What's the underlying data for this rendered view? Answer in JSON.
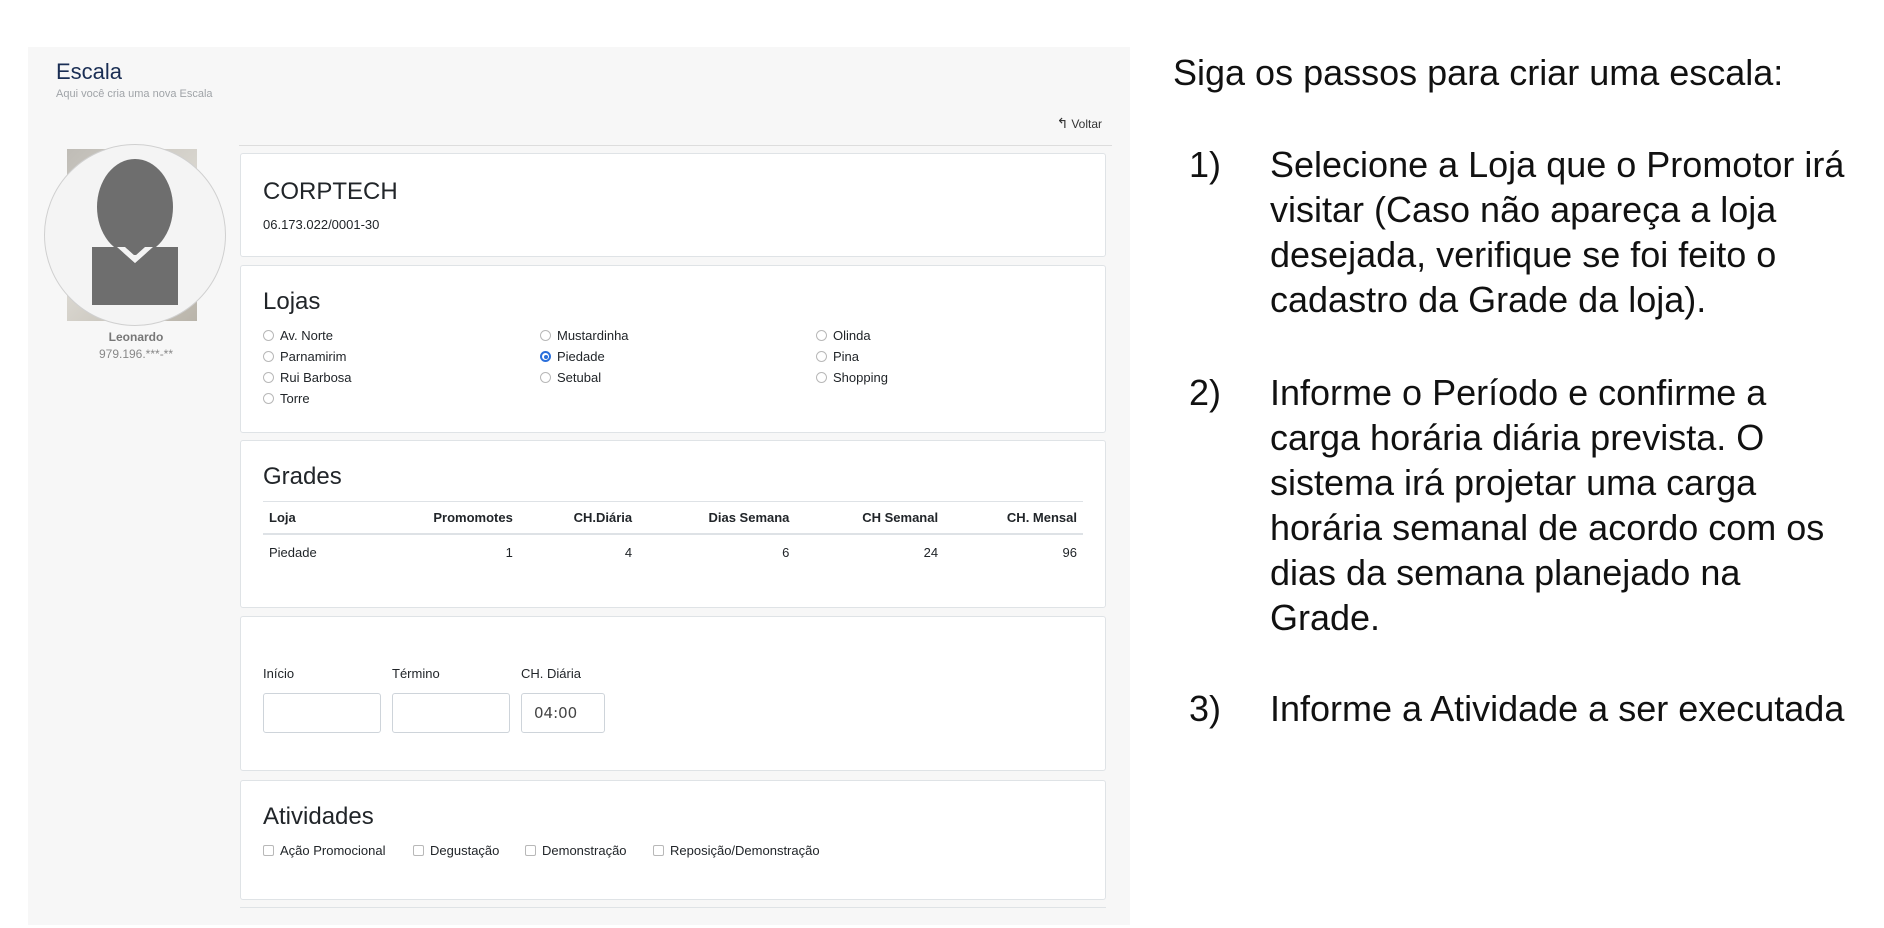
{
  "header": {
    "title": "Escala",
    "subtitle": "Aqui você cria uma nova Escala",
    "back_label": "Voltar"
  },
  "promoter": {
    "name": "Leonardo",
    "document": "979.196.***-**"
  },
  "company": {
    "name": "CORPTECH",
    "cnpj": "06.173.022/0001-30"
  },
  "stores": {
    "title": "Lojas",
    "options": [
      {
        "label": "Av. Norte",
        "selected": false
      },
      {
        "label": "Parnamirim",
        "selected": false
      },
      {
        "label": "Rui Barbosa",
        "selected": false
      },
      {
        "label": "Torre",
        "selected": false
      },
      {
        "label": "Mustardinha",
        "selected": false
      },
      {
        "label": "Piedade",
        "selected": true
      },
      {
        "label": "Setubal",
        "selected": false
      },
      {
        "label": "Olinda",
        "selected": false
      },
      {
        "label": "Pina",
        "selected": false
      },
      {
        "label": "Shopping",
        "selected": false
      }
    ]
  },
  "grades": {
    "title": "Grades",
    "columns": [
      "Loja",
      "Promomotes",
      "CH.Diária",
      "Dias Semana",
      "CH Semanal",
      "CH. Mensal"
    ],
    "rows": [
      [
        "Piedade",
        "1",
        "4",
        "6",
        "24",
        "96"
      ]
    ]
  },
  "period": {
    "start_label": "Início",
    "start_value": "",
    "end_label": "Término",
    "end_value": "",
    "daily_label": "CH. Diária",
    "daily_value": "04:00"
  },
  "activities": {
    "title": "Atividades",
    "options": [
      {
        "label": "Ação Promocional",
        "checked": false
      },
      {
        "label": "Degustação",
        "checked": false
      },
      {
        "label": "Demonstração",
        "checked": false
      },
      {
        "label": "Reposição/Demonstração",
        "checked": false
      }
    ]
  },
  "instructions": {
    "title": "Siga os passos para criar uma escala:",
    "steps": [
      {
        "number": "1)",
        "text": "Selecione a Loja que o Promotor irá visitar (Caso não apareça a loja desejada, verifique se foi feito o cadastro da Grade da loja)."
      },
      {
        "number": "2)",
        "text": "Informe o Período e confirme a carga horária diária prevista. O sistema irá projetar uma carga horária semanal de acordo com os dias da semana planejado na Grade."
      },
      {
        "number": "3)",
        "text": "Informe a Atividade a ser executada"
      }
    ]
  }
}
